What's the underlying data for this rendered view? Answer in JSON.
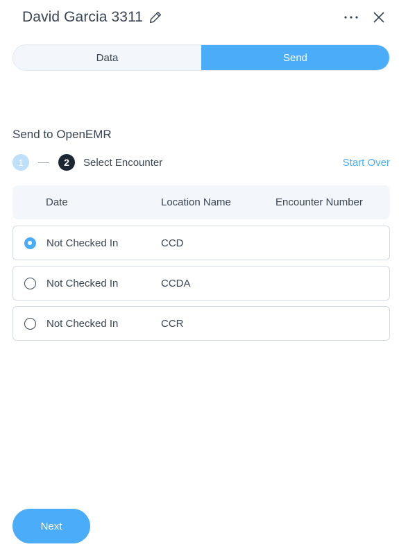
{
  "header": {
    "title": "David Garcia 3311",
    "icons": [
      "pencil-icon",
      "more-horizontal-icon",
      "close-icon"
    ]
  },
  "tabs": [
    {
      "label": "Data",
      "active": false
    },
    {
      "label": "Send",
      "active": true
    }
  ],
  "section": {
    "title": "Send to OpenEMR"
  },
  "stepper": {
    "step1": "1",
    "step2": "2",
    "current_label": "Select Encounter",
    "start_over": "Start Over"
  },
  "table": {
    "headers": [
      "Date",
      "Location Name",
      "Encounter Number"
    ],
    "rows": [
      {
        "date": "Not Checked In",
        "location": "CCD",
        "encounter": "",
        "selected": true
      },
      {
        "date": "Not Checked In",
        "location": "CCDA",
        "encounter": "",
        "selected": false
      },
      {
        "date": "Not Checked In",
        "location": "CCR",
        "encounter": "",
        "selected": false
      }
    ]
  },
  "footer": {
    "next_label": "Next"
  },
  "colors": {
    "accent": "#4badfa",
    "text": "#3a4452",
    "step_dark": "#1c2733",
    "step_done": "#bfe0fb"
  }
}
